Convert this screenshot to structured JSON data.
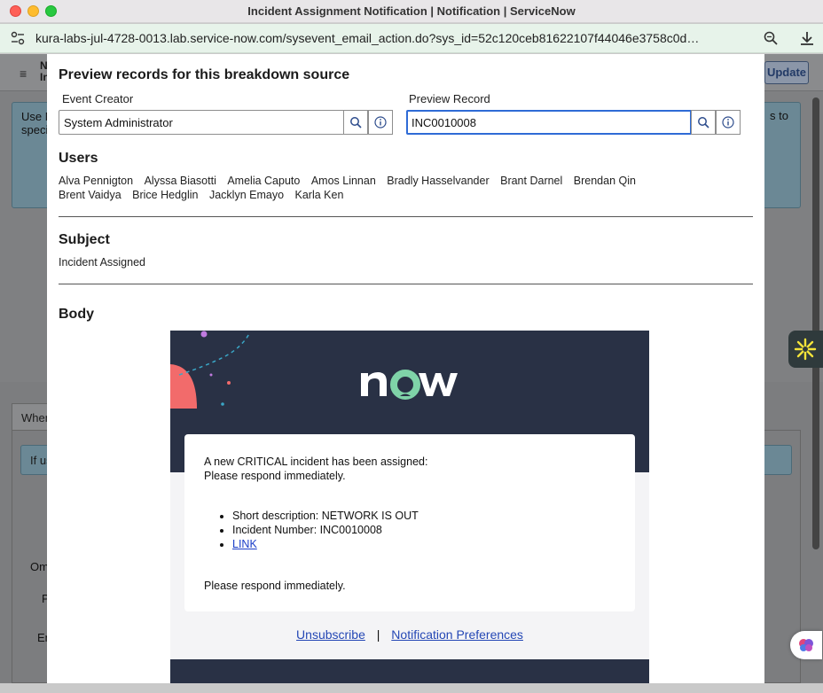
{
  "window": {
    "title": "Incident Assignment Notification | Notification | ServiceNow",
    "url": "kura-labs-jul-4728-0013.lab.service-now.com/sysevent_email_action.do?sys_id=52c120ceb81622107f44046e3758c0d…"
  },
  "background": {
    "menu_glyph": "≡",
    "header_title_line1": "N",
    "header_title_line2": "In",
    "update_label": "Update",
    "info_text_line1": "Use N",
    "info_text_line2": "speci",
    "info_text_right": "s to",
    "tab_label": "When",
    "ifus_label": "If us",
    "label_om": "Om",
    "label_p": "P",
    "label_en": "En"
  },
  "modal": {
    "title": "Preview records for this breakdown source",
    "event_creator_label": "Event Creator",
    "event_creator_value": "System Administrator",
    "preview_record_label": "Preview Record",
    "preview_record_value": "INC0010008",
    "users_heading": "Users",
    "users": [
      "Alva Pennigton",
      "Alyssa Biasotti",
      "Amelia Caputo",
      "Amos Linnan",
      "Bradly Hasselvander",
      "Brant Darnel",
      "Brendan Qin",
      "Brent Vaidya",
      "Brice Hedglin",
      "Jacklyn Emayo",
      "Karla Ken"
    ],
    "subject_heading": "Subject",
    "subject_value": "Incident Assigned",
    "body_heading": "Body"
  },
  "email": {
    "logo_text": "now",
    "intro_line1": "A new CRITICAL incident has been assigned:",
    "intro_line2": "Please respond immediately.",
    "bullet_short_description": "Short description: NETWORK IS OUT",
    "bullet_incident_number": "Incident Number: INC0010008",
    "bullet_link": "LINK",
    "closing": "Please respond immediately.",
    "unsubscribe": "Unsubscribe",
    "separator": "|",
    "preferences": "Notification Preferences"
  },
  "colors": {
    "email_header_bg": "#293145",
    "logo_accent": "#62d84e",
    "link": "#2447b5",
    "focus_border": "#2f6bd6"
  },
  "icons": {
    "search": "search-icon",
    "info": "info-icon",
    "download": "download-icon",
    "zoom": "zoom-icon",
    "site_settings": "site-settings-icon"
  }
}
